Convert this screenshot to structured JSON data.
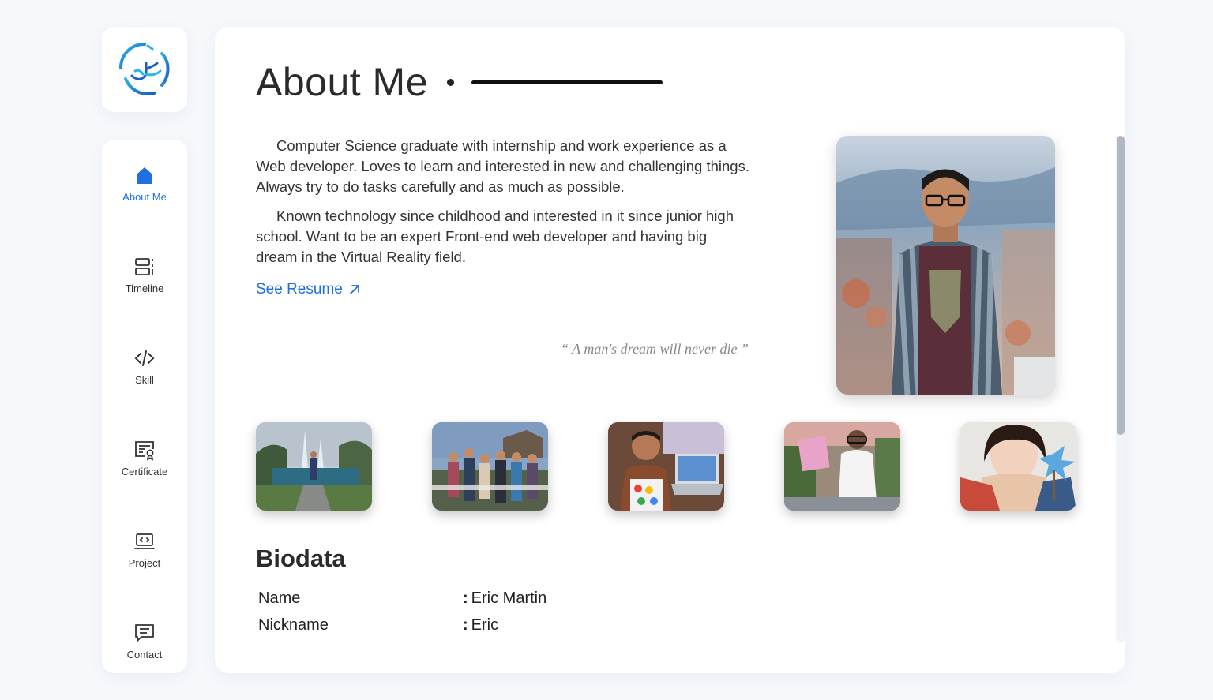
{
  "brand": {
    "logo_icon": "tree-circle-logo-icon"
  },
  "colors": {
    "accent": "#1f6fe0",
    "text": "#2b2b2b",
    "muted": "#888888",
    "background": "#f6f8fc"
  },
  "nav": {
    "items": [
      {
        "label": "About Me",
        "icon": "home-icon",
        "active": true
      },
      {
        "label": "Timeline",
        "icon": "timeline-icon",
        "active": false
      },
      {
        "label": "Skill",
        "icon": "code-icon",
        "active": false
      },
      {
        "label": "Certificate",
        "icon": "certificate-icon",
        "active": false
      },
      {
        "label": "Project",
        "icon": "laptop-code-icon",
        "active": false
      },
      {
        "label": "Contact",
        "icon": "chat-icon",
        "active": false
      }
    ]
  },
  "about": {
    "title": "About Me",
    "paragraphs": [
      "Computer Science graduate with internship and work experience as a Web developer. Loves to learn and interested in new and challenging things. Always try to do tasks carefully and as much as possible.",
      "Known technology since childhood and interested in it since junior high school. Want to be an expert Front-end web developer and having big dream in the Virtual Reality field."
    ],
    "resume_link": "See Resume",
    "quote": "“ A man's dream will never die ”"
  },
  "biodata": {
    "title": "Biodata",
    "rows": [
      {
        "key": "Name",
        "value": "Eric Martin"
      },
      {
        "key": "Nickname",
        "value": "Eric"
      }
    ]
  }
}
